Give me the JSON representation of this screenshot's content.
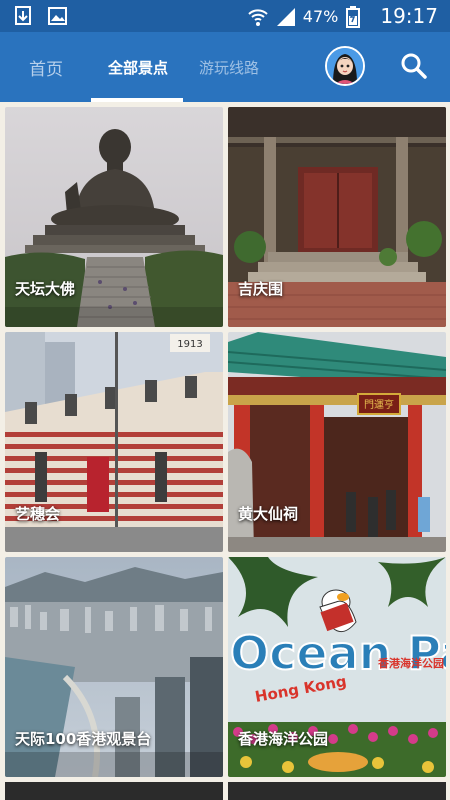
{
  "status_bar": {
    "battery_percent": "47%",
    "time": "19:17",
    "icons": [
      "download-icon",
      "image-icon",
      "wifi-icon",
      "signal-icon",
      "battery-icon"
    ]
  },
  "tabs": [
    {
      "label": "首页",
      "active": false
    },
    {
      "label": "全部景点",
      "active": true
    },
    {
      "label": "游玩线路",
      "active": false
    }
  ],
  "colors": {
    "status_bar": "#1f5fa3",
    "app_bar": "#2a73be",
    "page_bg": "#f3efe6"
  },
  "attractions": [
    {
      "name": "天坛大佛"
    },
    {
      "name": "吉庆围"
    },
    {
      "name": "艺穗会"
    },
    {
      "name": "黄大仙祠"
    },
    {
      "name": "天际100香港观景台"
    },
    {
      "name": "香港海洋公园"
    }
  ],
  "signage": {
    "ocean_park": "Ocean Park",
    "ocean_park_sub": "Hong Kong",
    "ocean_park_cn": "香港海洋公园",
    "temple_plaque": "門運亨",
    "fringe_year": "1913"
  }
}
